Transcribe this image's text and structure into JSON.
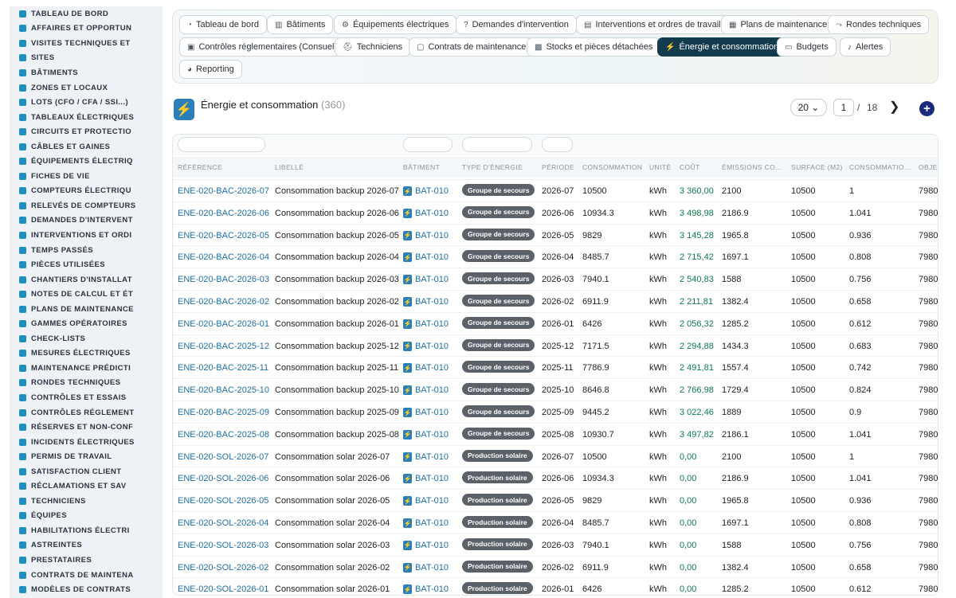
{
  "sidebar": {
    "items": [
      "TABLEAU DE BORD",
      "AFFAIRES ET OPPORTUN",
      "VISITES TECHNIQUES ET",
      "SITES",
      "BÂTIMENTS",
      "ZONES ET LOCAUX",
      "LOTS (CFO / CFA / SSI...)",
      "TABLEAUX ÉLECTRIQUES",
      "CIRCUITS ET PROTECTIO",
      "CÂBLES ET GAINES",
      "ÉQUIPEMENTS ÉLECTRIQ",
      "FICHES DE VIE",
      "COMPTEURS ÉLECTRIQU",
      "RELEVÉS DE COMPTEURS",
      "DEMANDES D'INTERVENT",
      "INTERVENTIONS ET ORDI",
      "TEMPS PASSÉS",
      "PIÈCES UTILISÉES",
      "CHANTIERS D'INSTALLAT",
      "NOTES DE CALCUL ET ÉT",
      "PLANS DE MAINTENANCE",
      "GAMMES OPÉRATOIRES",
      "CHECK-LISTS",
      "MESURES ÉLECTRIQUES",
      "MAINTENANCE PRÉDICTI",
      "RONDES TECHNIQUES",
      "CONTRÔLES ET ESSAIS",
      "CONTRÔLES RÉGLEMENT",
      "RÉSERVES ET NON-CONF",
      "INCIDENTS ÉLECTRIQUES",
      "PERMIS DE TRAVAIL",
      "SATISFACTION CLIENT",
      "RÉCLAMATIONS ET SAV",
      "TECHNICIENS",
      "ÉQUIPES",
      "HABILITATIONS ÉLECTRI",
      "ASTREINTES",
      "PRESTATAIRES",
      "CONTRATS DE MAINTENA",
      "MODÈLES DE CONTRATS"
    ]
  },
  "tabs": [
    {
      "label": "Tableau de bord",
      "icon": "gauge-icon",
      "active": false
    },
    {
      "label": "Bâtiments",
      "icon": "building-icon",
      "active": false
    },
    {
      "label": "Équipements électriques",
      "icon": "cogs-icon",
      "active": false
    },
    {
      "label": "Demandes d'intervention",
      "icon": "question-icon",
      "active": false
    },
    {
      "label": "Interventions et ordres de travail",
      "icon": "clipboard-icon",
      "active": false
    },
    {
      "label": "Plans de maintenance",
      "icon": "calendar-icon",
      "active": false
    },
    {
      "label": "Rondes techniques",
      "icon": "route-icon",
      "active": false
    },
    {
      "label": "Contrôles réglementaires (Consuel)",
      "icon": "clipboard-check-icon",
      "active": false
    },
    {
      "label": "Techniciens",
      "icon": "hard-hat-icon",
      "active": false
    },
    {
      "label": "Contrats de maintenance",
      "icon": "file-icon",
      "active": false
    },
    {
      "label": "Stocks et pièces détachées",
      "icon": "boxes-icon",
      "active": false
    },
    {
      "label": "Énergie et consommation",
      "icon": "bolt-icon",
      "active": true
    },
    {
      "label": "Budgets",
      "icon": "money-icon",
      "active": false
    },
    {
      "label": "Alertes",
      "icon": "bell-icon",
      "active": false
    },
    {
      "label": "Reporting",
      "icon": "chart-pie-icon",
      "active": false
    }
  ],
  "header": {
    "title": "Énergie et consommation",
    "count": "(360)",
    "page_size": "20 ⌄",
    "page": "1",
    "page_sep": "/",
    "page_total": "18"
  },
  "table": {
    "columns": [
      "RÉFÉRENCE",
      "LIBELLÉ",
      "BÂTIMENT",
      "TYPE D'ÉNERGIE",
      "PÉRIODE",
      "CONSOMMATION",
      "UNITÉ",
      "COÛT",
      "ÉMISSIONS CO...",
      "SURFACE (M2)",
      "CONSOMMATIO...",
      "OBJEC"
    ],
    "rows": [
      [
        "ENE-020-BAC-2026-07",
        "Consommation backup 2026-07",
        "BAT-010",
        "Groupe de secours",
        "2026-07",
        "10500",
        "kWh",
        "3 360,00",
        "2100",
        "10500",
        "1",
        "7980"
      ],
      [
        "ENE-020-BAC-2026-06",
        "Consommation backup 2026-06",
        "BAT-010",
        "Groupe de secours",
        "2026-06",
        "10934.3",
        "kWh",
        "3 498,98",
        "2186.9",
        "10500",
        "1.041",
        "7980"
      ],
      [
        "ENE-020-BAC-2026-05",
        "Consommation backup 2026-05",
        "BAT-010",
        "Groupe de secours",
        "2026-05",
        "9829",
        "kWh",
        "3 145,28",
        "1965.8",
        "10500",
        "0.936",
        "7980"
      ],
      [
        "ENE-020-BAC-2026-04",
        "Consommation backup 2026-04",
        "BAT-010",
        "Groupe de secours",
        "2026-04",
        "8485.7",
        "kWh",
        "2 715,42",
        "1697.1",
        "10500",
        "0.808",
        "7980"
      ],
      [
        "ENE-020-BAC-2026-03",
        "Consommation backup 2026-03",
        "BAT-010",
        "Groupe de secours",
        "2026-03",
        "7940.1",
        "kWh",
        "2 540,83",
        "1588",
        "10500",
        "0.756",
        "7980"
      ],
      [
        "ENE-020-BAC-2026-02",
        "Consommation backup 2026-02",
        "BAT-010",
        "Groupe de secours",
        "2026-02",
        "6911.9",
        "kWh",
        "2 211,81",
        "1382.4",
        "10500",
        "0.658",
        "7980"
      ],
      [
        "ENE-020-BAC-2026-01",
        "Consommation backup 2026-01",
        "BAT-010",
        "Groupe de secours",
        "2026-01",
        "6426",
        "kWh",
        "2 056,32",
        "1285.2",
        "10500",
        "0.612",
        "7980"
      ],
      [
        "ENE-020-BAC-2025-12",
        "Consommation backup 2025-12",
        "BAT-010",
        "Groupe de secours",
        "2025-12",
        "7171.5",
        "kWh",
        "2 294,88",
        "1434.3",
        "10500",
        "0.683",
        "7980"
      ],
      [
        "ENE-020-BAC-2025-11",
        "Consommation backup 2025-11",
        "BAT-010",
        "Groupe de secours",
        "2025-11",
        "7786.9",
        "kWh",
        "2 491,81",
        "1557.4",
        "10500",
        "0.742",
        "7980"
      ],
      [
        "ENE-020-BAC-2025-10",
        "Consommation backup 2025-10",
        "BAT-010",
        "Groupe de secours",
        "2025-10",
        "8646.8",
        "kWh",
        "2 766,98",
        "1729.4",
        "10500",
        "0.824",
        "7980"
      ],
      [
        "ENE-020-BAC-2025-09",
        "Consommation backup 2025-09",
        "BAT-010",
        "Groupe de secours",
        "2025-09",
        "9445.2",
        "kWh",
        "3 022,46",
        "1889",
        "10500",
        "0.9",
        "7980"
      ],
      [
        "ENE-020-BAC-2025-08",
        "Consommation backup 2025-08",
        "BAT-010",
        "Groupe de secours",
        "2025-08",
        "10930.7",
        "kWh",
        "3 497,82",
        "2186.1",
        "10500",
        "1.041",
        "7980"
      ],
      [
        "ENE-020-SOL-2026-07",
        "Consommation solar 2026-07",
        "BAT-010",
        "Production solaire",
        "2026-07",
        "10500",
        "kWh",
        "0,00",
        "2100",
        "10500",
        "1",
        "7980"
      ],
      [
        "ENE-020-SOL-2026-06",
        "Consommation solar 2026-06",
        "BAT-010",
        "Production solaire",
        "2026-06",
        "10934.3",
        "kWh",
        "0,00",
        "2186.9",
        "10500",
        "1.041",
        "7980"
      ],
      [
        "ENE-020-SOL-2026-05",
        "Consommation solar 2026-05",
        "BAT-010",
        "Production solaire",
        "2026-05",
        "9829",
        "kWh",
        "0,00",
        "1965.8",
        "10500",
        "0.936",
        "7980"
      ],
      [
        "ENE-020-SOL-2026-04",
        "Consommation solar 2026-04",
        "BAT-010",
        "Production solaire",
        "2026-04",
        "8485.7",
        "kWh",
        "0,00",
        "1697.1",
        "10500",
        "0.808",
        "7980"
      ],
      [
        "ENE-020-SOL-2026-03",
        "Consommation solar 2026-03",
        "BAT-010",
        "Production solaire",
        "2026-03",
        "7940.1",
        "kWh",
        "0,00",
        "1588",
        "10500",
        "0.756",
        "7980"
      ],
      [
        "ENE-020-SOL-2026-02",
        "Consommation solar 2026-02",
        "BAT-010",
        "Production solaire",
        "2026-02",
        "6911.9",
        "kWh",
        "0,00",
        "1382.4",
        "10500",
        "0.658",
        "7980"
      ],
      [
        "ENE-020-SOL-2026-01",
        "Consommation solar 2026-01",
        "BAT-010",
        "Production solaire",
        "2026-01",
        "6426",
        "kWh",
        "0,00",
        "1285.2",
        "10500",
        "0.612",
        "7980"
      ]
    ]
  }
}
